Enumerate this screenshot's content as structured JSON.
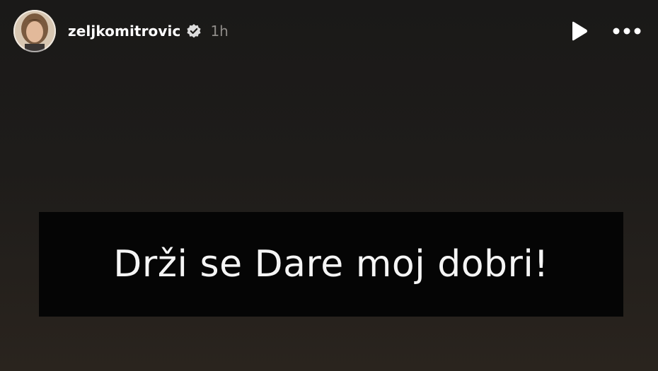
{
  "story": {
    "username": "zeljkomitrovic",
    "time_ago": "1h",
    "text": "Drži se Dare moj dobri!"
  },
  "icons": {
    "avatar": "avatar",
    "verified": "verified-badge-icon",
    "play": "play-icon",
    "more": "more-options-icon"
  },
  "colors": {
    "background": "#1b1916",
    "text_box": "#050505",
    "text": "#f5f5f5",
    "muted": "#8f8c88"
  }
}
